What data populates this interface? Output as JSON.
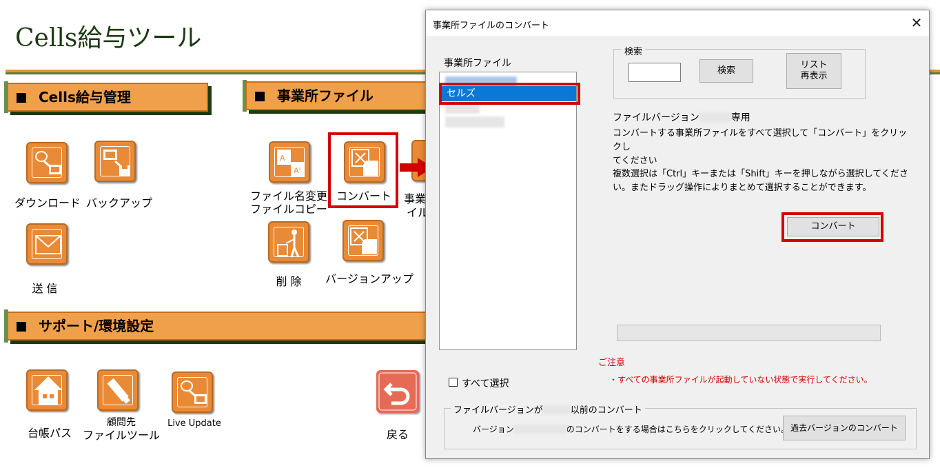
{
  "app": {
    "title": "Cells給与ツール",
    "sections": {
      "payroll": "Cells給与管理",
      "office_files": "事業所ファイル",
      "support": "サポート/環境設定"
    },
    "tiles": {
      "download": "ダウンロード",
      "backup": "バックアップ",
      "send": "送 信",
      "rename_copy_line1": "ファイル名変更",
      "rename_copy_line2": "ファイルコピー",
      "convert": "コンバート",
      "office_partial_line1": "事業",
      "office_partial_line2": "イル",
      "delete": "削 除",
      "version_up": "バージョンアップ",
      "ledger_path": "台帳パス",
      "advisor_line1": "顧問先",
      "advisor_line2": "ファイルツール",
      "live_update": "Live Update",
      "back": "戻る"
    }
  },
  "dialog": {
    "title": "事業所ファイルのコンバート",
    "close_glyph": "✕",
    "list_label": "事業所ファイル",
    "list_items": [
      "セルズ"
    ],
    "search": {
      "legend": "検索",
      "input_value": "",
      "search_button": "検索",
      "refresh_line1": "リスト",
      "refresh_line2": "再表示"
    },
    "version_prefix": "ファイルバージョン",
    "version_suffix": "専用",
    "instruction1_line1": "コンバートする事業所ファイルをすべて選択して「コンバート」をクリックし",
    "instruction1_line2": "てください",
    "instruction2_line1": "複数選択は「Ctrl」キーまたは「Shift」キーを押しながら選択してくださ",
    "instruction2_line2": "い。またドラッグ操作によりまとめて選択することができます。",
    "convert_button": "コンバート",
    "caution_title": "ご注意",
    "caution_text": "・すべての事業所ファイルが起動していない状態で実行してください。",
    "select_all": "すべて選択",
    "old_version": {
      "legend_prefix": "ファイルバージョンが",
      "legend_suffix": "以前のコンバート",
      "desc_prefix": "バージョン",
      "desc_suffix": "のコンバートをする場合はこちらをクリックしてください。⇒",
      "button": "過去バージョンのコンバート"
    }
  },
  "colors": {
    "tile_orange": "#e98a37",
    "section_orange": "#f0a04b",
    "highlight_red": "#d40000",
    "selection_blue": "#0a78d7",
    "caution_red": "#d40000"
  }
}
